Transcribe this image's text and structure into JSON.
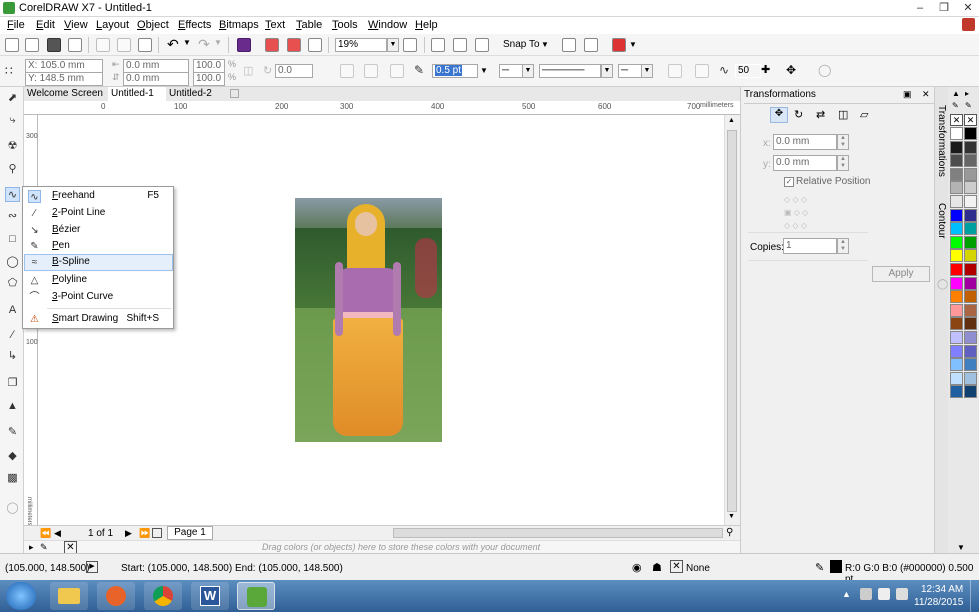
{
  "window": {
    "title": "CorelDRAW X7 - Untitled-1"
  },
  "menu": [
    "File",
    "Edit",
    "View",
    "Layout",
    "Object",
    "Effects",
    "Bitmaps",
    "Text",
    "Table",
    "Tools",
    "Window",
    "Help"
  ],
  "toolbar": {
    "zoom": "19%",
    "snap_to": "Snap To"
  },
  "property_bar": {
    "x": "X: 105.0 mm",
    "y": "Y: 148.5 mm",
    "w": "0.0 mm",
    "h": "0.0 mm",
    "scale_w": "100.0",
    "scale_h": "100.0",
    "pct": "%",
    "angle": "0.0",
    "outline": "0.5 pt",
    "smoothing": "50"
  },
  "tabs": [
    "Welcome Screen",
    "Untitled-1",
    "Untitled-2"
  ],
  "ruler": {
    "h_ticks": [
      "0",
      "100",
      "200",
      "300",
      "400",
      "500",
      "600",
      "700"
    ],
    "h_unit": "millimeters",
    "v_ticks": [
      "300",
      "200",
      "100"
    ],
    "v_unit": "millimeters"
  },
  "flyout": [
    {
      "label": "Freehand",
      "shortcut": "F5",
      "icon": "freehand-icon"
    },
    {
      "label": "2-Point Line",
      "shortcut": "",
      "icon": "two-point-line-icon"
    },
    {
      "label": "Bézier",
      "shortcut": "",
      "icon": "bezier-icon"
    },
    {
      "label": "Pen",
      "shortcut": "",
      "icon": "pen-icon"
    },
    {
      "label": "B-Spline",
      "shortcut": "",
      "icon": "b-spline-icon"
    },
    {
      "label": "Polyline",
      "shortcut": "",
      "icon": "polyline-icon"
    },
    {
      "label": "3-Point Curve",
      "shortcut": "",
      "icon": "three-point-curve-icon"
    },
    {
      "label": "Smart Drawing",
      "shortcut": "Shift+S",
      "icon": "smart-drawing-icon"
    }
  ],
  "page_nav": {
    "count": "1 of 1",
    "page_tab": "Page 1"
  },
  "color_bar_hint": "Drag colors (or objects) here to store these colors with your document",
  "docker": {
    "title": "Transformations",
    "x": "0.0 mm",
    "y": "0.0 mm",
    "x_label": "x:",
    "y_label": "y:",
    "relative_position": "Relative Position",
    "copies_label": "Copies:",
    "copies": "1",
    "apply": "Apply",
    "side_tabs": [
      "Transformations",
      "Contour"
    ]
  },
  "status": {
    "coords": "(105.000, 148.500)",
    "start_end": "Start: (105.000, 148.500)  End: (105.000, 148.500)",
    "fill": "None",
    "outline": "R:0 G:0 B:0 (#000000)  0.500 pt"
  },
  "taskbar": {
    "time": "12:34 AM",
    "date": "11/28/2015"
  },
  "palette_colors": [
    "#ffffff",
    "#000000",
    "#1a1a1a",
    "#333333",
    "#4d4d4d",
    "#666666",
    "#808080",
    "#999999",
    "#b3b3b3",
    "#cccccc",
    "#e6e6e6",
    "#f2f2f2",
    "#0000ff",
    "#2e2e8f",
    "#00bfff",
    "#00a0a0",
    "#00ff00",
    "#00a000",
    "#ffff00",
    "#d4d400",
    "#ff0000",
    "#b00000",
    "#ff00ff",
    "#a000a0",
    "#ff8000",
    "#c06000",
    "#ff9999",
    "#aa6644",
    "#8b4513",
    "#603010",
    "#c0c0ff",
    "#9090d0",
    "#8080ff",
    "#6060c0",
    "#80c0ff",
    "#4080c0",
    "#c0e0ff",
    "#a0c0e0",
    "#2060a0",
    "#104070"
  ]
}
